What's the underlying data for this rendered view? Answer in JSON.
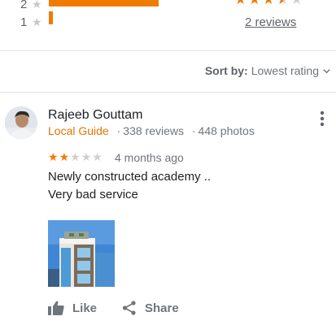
{
  "distribution": [
    {
      "label": "2",
      "star": "★",
      "fraction": 0.27
    },
    {
      "label": "1",
      "star": "★",
      "fraction": 0.01
    }
  ],
  "summary": {
    "rating": 3.5,
    "reviews_link": "2 reviews"
  },
  "sort": {
    "label": "Sort by:",
    "value": "Lowest rating"
  },
  "review": {
    "name": "Rajeeb Gouttam",
    "badge": "Local Guide",
    "reviews_count": "338 reviews",
    "photos_count": "448 photos",
    "meta_separator": "·",
    "rating": 2,
    "max_rating": 5,
    "time": "4 months ago",
    "text_line1": "Newly constructed academy ..",
    "text_line2": "Very bad service",
    "like_label": "Like",
    "share_label": "Share"
  },
  "icons": {
    "more": "more-vert-icon",
    "sort": "chevron-down-icon",
    "like": "thumb-up-icon",
    "share": "share-icon"
  },
  "colors": {
    "accent": "#f07b00",
    "badge": "#e37400",
    "muted": "#70757a"
  }
}
